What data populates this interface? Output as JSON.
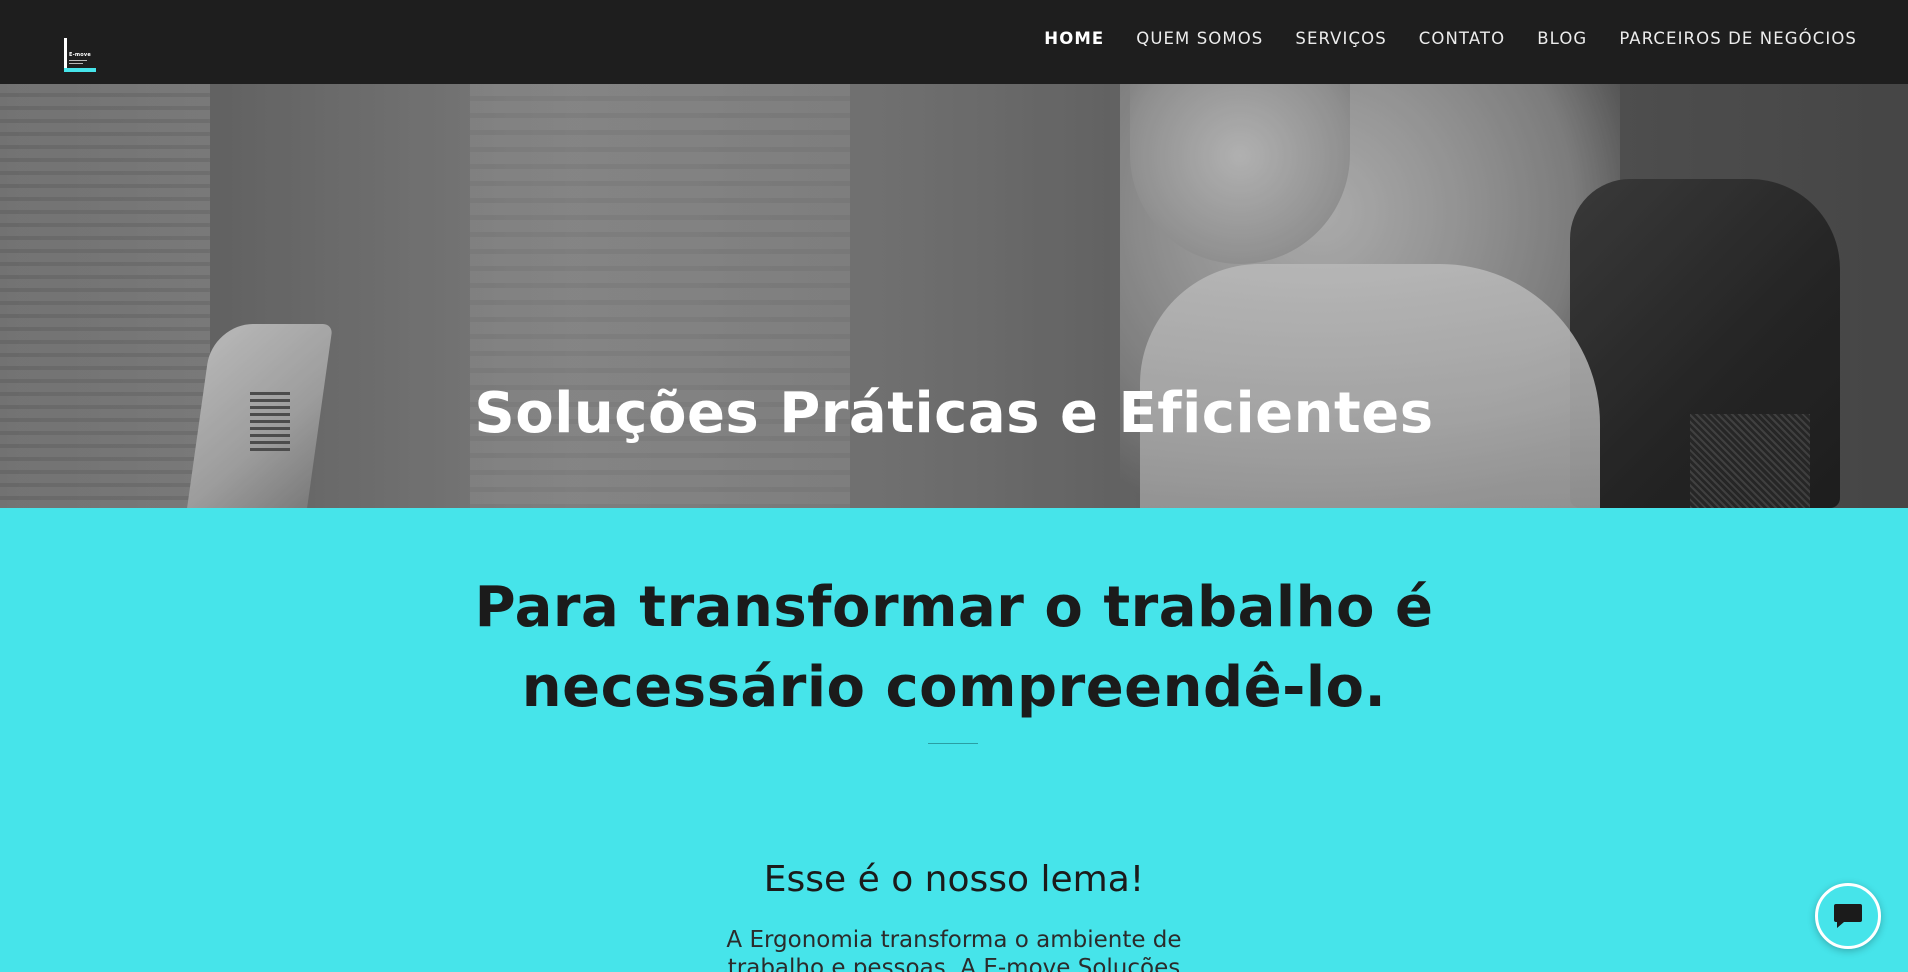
{
  "header": {
    "logo": {
      "brand": "E-move",
      "icon": "logo-icon"
    },
    "nav": [
      {
        "label": "HOME",
        "active": true
      },
      {
        "label": "QUEM SOMOS",
        "active": false
      },
      {
        "label": "SERVIÇOS",
        "active": false
      },
      {
        "label": "CONTATO",
        "active": false
      },
      {
        "label": "BLOG",
        "active": false
      },
      {
        "label": "PARCEIROS DE NEGÓCIOS",
        "active": false
      }
    ]
  },
  "hero": {
    "title": "Soluções Práticas e Eficientes"
  },
  "section": {
    "title_line1": "Para transformar o trabalho é",
    "title_line2": "necessário compreendê-lo.",
    "subheading": "Esse é o nosso lema!",
    "body_line1": "A Ergonomia transforma o ambiente de",
    "body_line2": "trabalho e pessoas. A E-move Soluções"
  },
  "chat": {
    "icon": "chat-bubble-icon"
  },
  "colors": {
    "header_bg": "#1e1e1e",
    "accent": "#46e4ea",
    "heading_text": "#1b1b1b"
  }
}
